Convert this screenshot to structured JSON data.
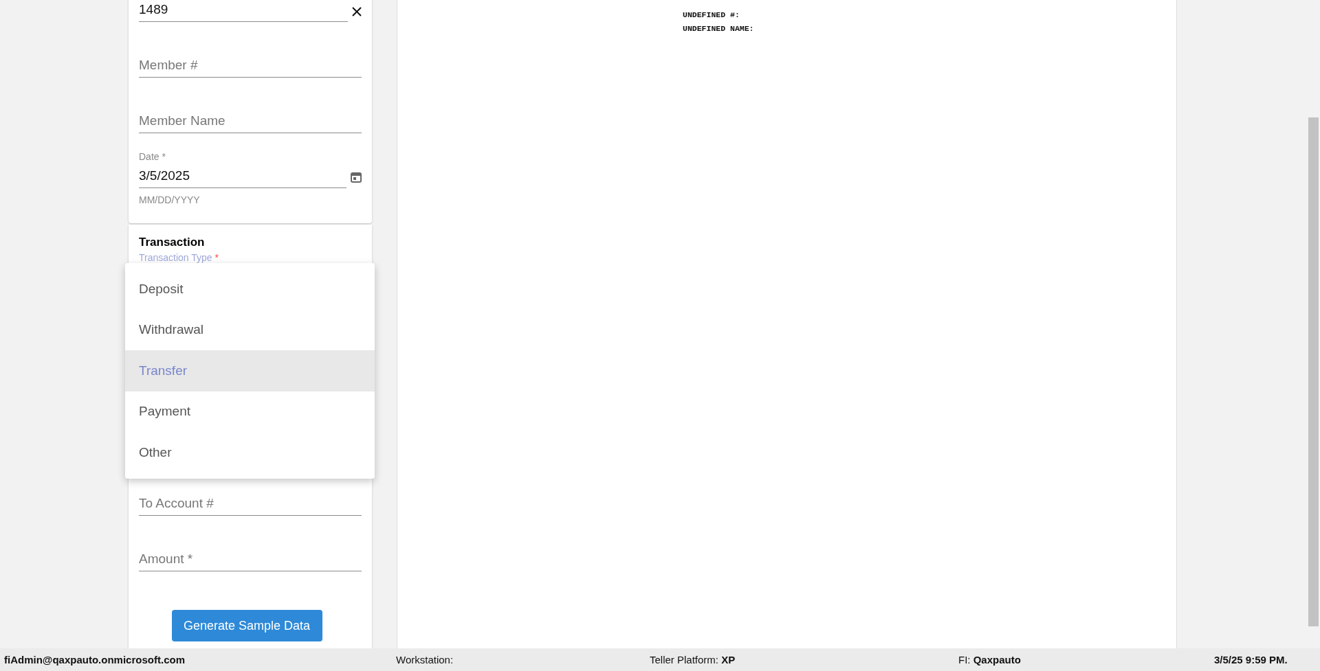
{
  "id_field": {
    "value": "1489"
  },
  "member_fields": [
    {
      "placeholder": "Member #"
    },
    {
      "placeholder": "Member Name"
    }
  ],
  "date_field": {
    "label": "Date *",
    "value": "3/5/2025",
    "helper": "MM/DD/YYYY"
  },
  "transaction": {
    "title": "Transaction",
    "type_label": "Transaction Type",
    "required_mark": "*",
    "options": [
      {
        "label": "Deposit",
        "selected": false
      },
      {
        "label": "Withdrawal",
        "selected": false
      },
      {
        "label": "Transfer",
        "selected": true
      },
      {
        "label": "Payment",
        "selected": false
      },
      {
        "label": "Other",
        "selected": false
      }
    ]
  },
  "lower_fields": [
    {
      "placeholder": "To Account #"
    },
    {
      "placeholder": "Amount *"
    }
  ],
  "button": "Generate Sample Data",
  "receipt": {
    "lines": [
      {
        "label": "UNDEFINED #:"
      },
      {
        "label": "UNDEFINED NAME:"
      }
    ]
  },
  "status_bar": {
    "user": "fiAdmin@qaxpauto.onmicrosoft.com",
    "workstation": "Workstation:",
    "platform": "Teller Platform: **XP**",
    "fi": "FI: **Qaxpauto**",
    "datetime": "3/5/25 9:59 PM."
  }
}
